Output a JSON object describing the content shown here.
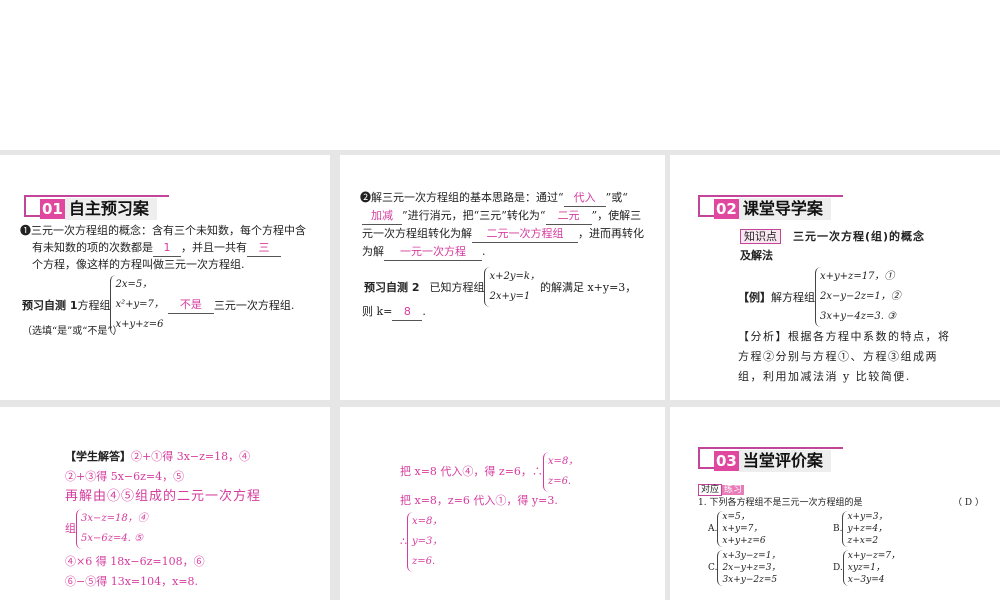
{
  "slides": [
    {
      "section_num": "01",
      "section_title": "自主预习案",
      "p1_a": "❶三元一次方程组的概念：含有三个未知数，每个方程中含",
      "p1_b": "有未知数的项的次数都是",
      "ans1": "1",
      "p1_c": "，并且一共有",
      "ans2": "三",
      "p1_d": "个方程，像这样的方程叫做三元一次方程组.",
      "test_label": "预习自测 1",
      "test_text": "方程组",
      "eqs": [
        "2x=5，",
        "x²+y=7，",
        "x+y+z=6"
      ],
      "ans3": "不是",
      "test_tail": "三元一次方程组.",
      "note": "（选填“是”或“不是”）"
    },
    {
      "p2_a": "❷解三元一次方程组的基本思路是：通过“",
      "ans1": "代入",
      "p2_b": "”或“",
      "ans2": "加减",
      "p2_c": "”进行消元，把“三元”转化为“",
      "ans3": "二元",
      "p2_d": "”，使解三",
      "p2_e": "元一次方程组转化为解",
      "ans4": "二元一次方程组",
      "p2_f": "，进而再转化",
      "p2_g": "为解",
      "ans5": "一元一次方程",
      "p2_h": ".",
      "test_label": "预习自测 2",
      "test_text": "已知方程组",
      "eqs": [
        "x+2y=k，",
        "2x+y=1"
      ],
      "test_tail": "的解满足 x+y=3，",
      "k_text": "则 k=",
      "ans6": "8"
    },
    {
      "section_num": "02",
      "section_title": "课堂导学案",
      "tag": "知识点",
      "topic_a": "三元一次方程(组)的概念",
      "topic_b": "及解法",
      "example_label": "【例】",
      "example_text": "解方程组",
      "eqs": [
        "x+y+z=17，①",
        "2x−y−2z=1，②",
        "3x+y−4z=3. ③"
      ],
      "analysis": [
        "【分析】根据各方程中系数的特点，将",
        "方程②分别与方程①、方程③组成两",
        "组，利用加减法消 y 比较简便."
      ]
    },
    {
      "label": "【学生解答】",
      "l1": "②+①得 3x−z=18，④",
      "l2": "②+③得 5x−6z=4，⑤",
      "l3": "再解由④⑤组成的二元一次方程",
      "l4": "组",
      "eqs": [
        "3x−z=18，④",
        "5x−6z=4. ⑤"
      ],
      "l5": "④×6 得 18x−6z=108，⑥",
      "l6": "⑥−⑤得 13x=104，x=8."
    },
    {
      "l1": "把 x=8 代入④，得 z=6，∴",
      "eqs1": [
        "x=8，",
        "z=6."
      ],
      "l2": "把 x=8，z=6 代入①，得 y=3.",
      "therefore": "∴",
      "eqs2": [
        "x=8，",
        "y=3，",
        "z=6."
      ]
    },
    {
      "section_num": "03",
      "section_title": "当堂评价案",
      "tag_a": "对应",
      "tag_b": "练习",
      "q": "1. 下列各方程组不是三元一次方程组的是",
      "answer": "（ D ）",
      "options": [
        {
          "label": "A.",
          "eqs": [
            "x=5，",
            "x+y=7，",
            "x+y+z=6"
          ]
        },
        {
          "label": "B.",
          "eqs": [
            "x+y=3，",
            "y+z=4，",
            "z+x=2"
          ]
        },
        {
          "label": "C.",
          "eqs": [
            "x+3y−z=1，",
            "2x−y+z=3，",
            "3x+y−2z=5"
          ]
        },
        {
          "label": "D.",
          "eqs": [
            "x+y−z=7，",
            "xyz=1，",
            "x−3y=4"
          ]
        }
      ]
    }
  ],
  "colors": {
    "accent": "#d63c9e",
    "background": "#e6e6e6"
  }
}
